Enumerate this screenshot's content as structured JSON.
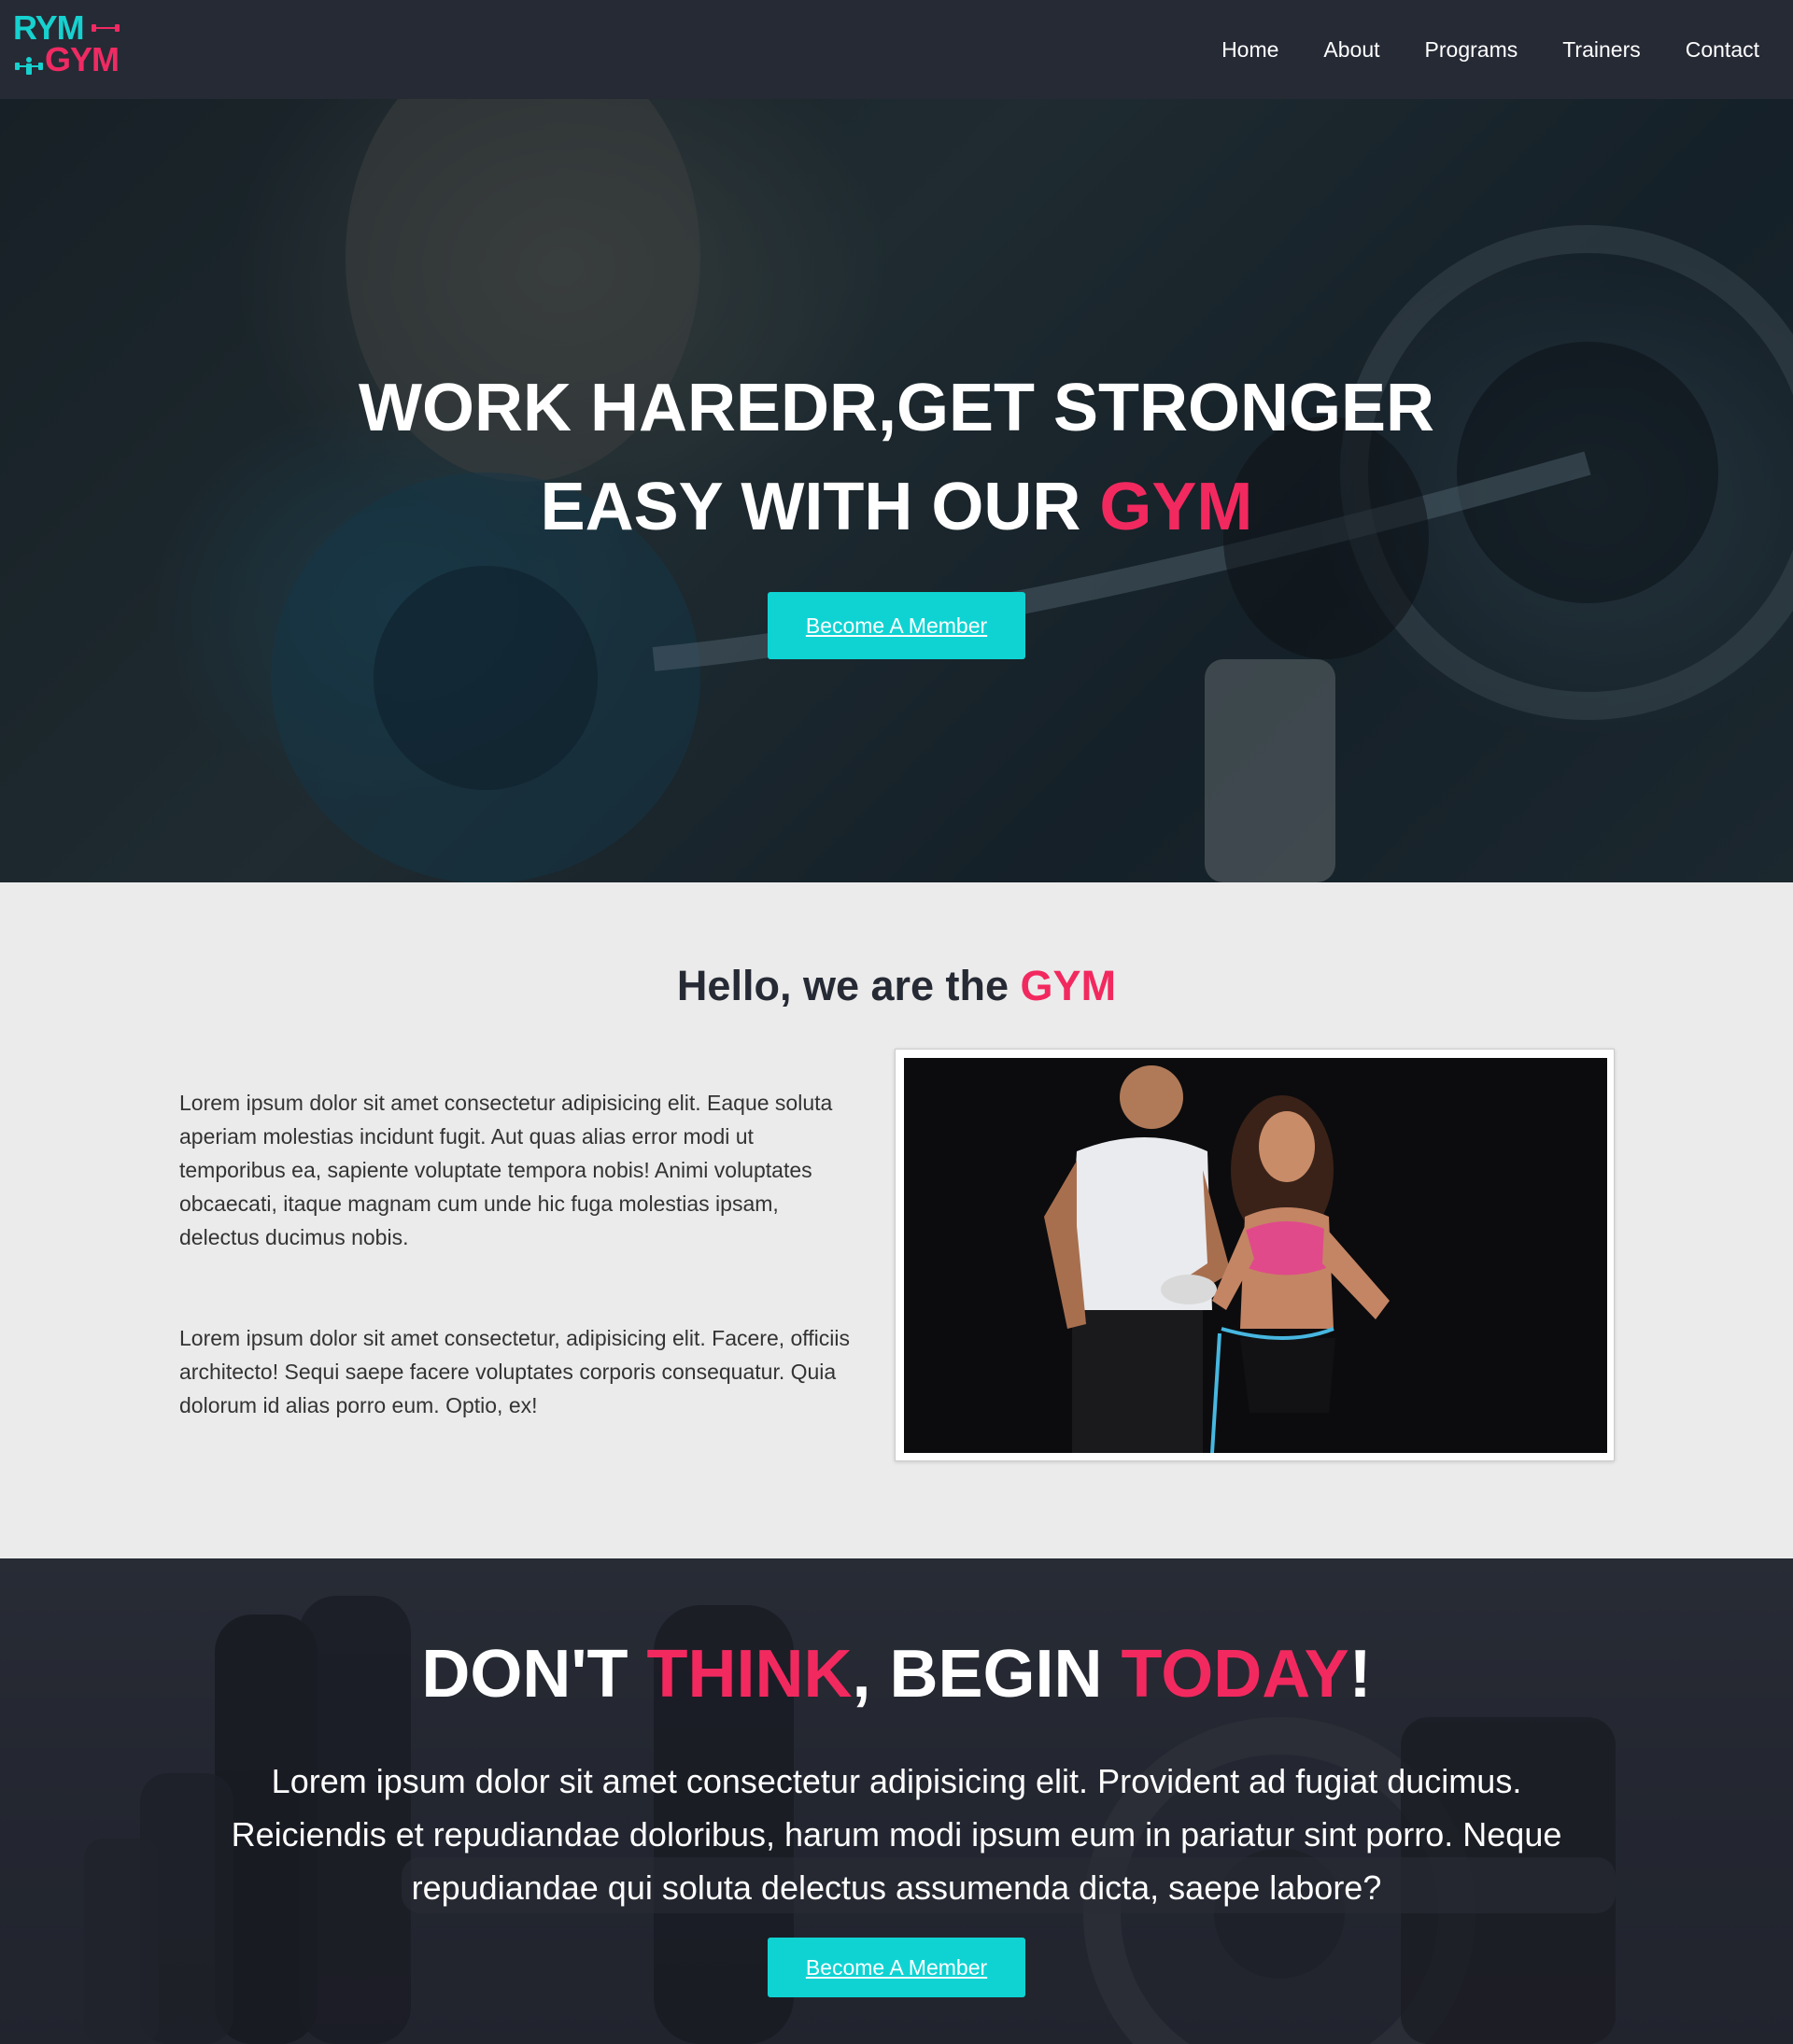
{
  "brand": {
    "logo_line1": "RYM",
    "logo_line2": "GYM"
  },
  "nav": {
    "items": [
      "Home",
      "About",
      "Programs",
      "Trainers",
      "Contact"
    ]
  },
  "hero": {
    "title_line1": "WORK HAREDR,GET STRONGER",
    "title_line2_prefix": "EASY WITH OUR ",
    "title_line2_accent": "GYM",
    "button_label": "Become A Member"
  },
  "about": {
    "heading_prefix": "Hello, we are the ",
    "heading_accent": "GYM",
    "paragraph1": "Lorem ipsum dolor sit amet consectetur adipisicing elit. Eaque soluta aperiam molestias incidunt fugit. Aut quas alias error modi ut temporibus ea, sapiente voluptate tempora nobis! Animi voluptates obcaecati, itaque magnam cum unde hic fuga molestias ipsam, delectus ducimus nobis.",
    "paragraph2": "Lorem ipsum dolor sit amet consectetur, adipisicing elit. Facere, officiis architecto! Sequi saepe facere voluptates corporis consequatur. Quia dolorum id alias porro eum. Optio, ex!"
  },
  "cta": {
    "title_part1": "DON'T ",
    "title_accent1": "THINK",
    "title_part2": ", BEGIN ",
    "title_accent2": "TODAY",
    "title_part3": "!",
    "text": "Lorem ipsum dolor sit amet consectetur adipisicing elit. Provident ad fugiat ducimus. Reiciendis et repudiandae doloribus, harum modi ipsum eum in pariatur sint porro. Neque repudiandae qui soluta delectus assumenda dicta, saepe labore?",
    "button_label": "Become A Member"
  },
  "colors": {
    "accent_pink": "#f2295f",
    "accent_cyan": "#0fd3d3",
    "nav_bg": "#262a35",
    "section_bg": "#ebebeb"
  }
}
